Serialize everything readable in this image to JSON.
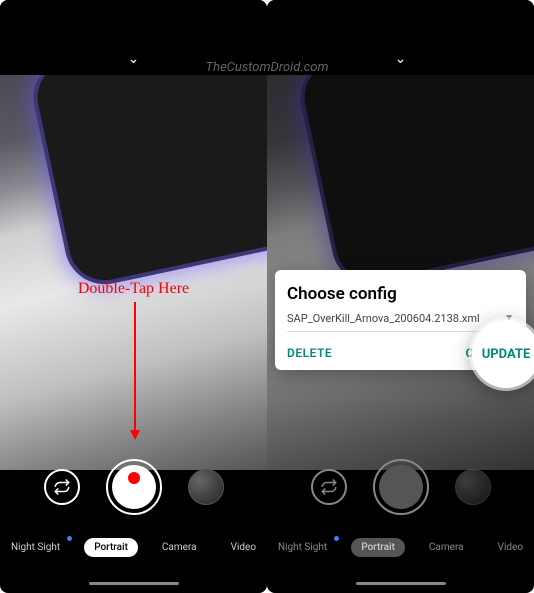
{
  "watermark": "TheCustomDroid.com",
  "annotation_text": "Double-Tap Here",
  "left": {
    "modes": [
      {
        "label": "Night Sight",
        "active": false,
        "dot": true
      },
      {
        "label": "Portrait",
        "active": true,
        "dot": false
      },
      {
        "label": "Camera",
        "active": false,
        "dot": false
      },
      {
        "label": "Video",
        "active": false,
        "dot": false
      }
    ]
  },
  "right": {
    "modes": [
      {
        "label": "Night Sight",
        "active": false,
        "dot": true
      },
      {
        "label": "Portrait",
        "active": true,
        "dot": false
      },
      {
        "label": "Camera",
        "active": false,
        "dot": false
      },
      {
        "label": "Video",
        "active": false,
        "dot": false
      }
    ],
    "dialog": {
      "title": "Choose config",
      "filename": "SAP_OverKill_Arnova_200604.2138.xml",
      "delete_label": "DELETE",
      "cancel_label": "CANCEL",
      "update_label": "UPDATE"
    }
  }
}
